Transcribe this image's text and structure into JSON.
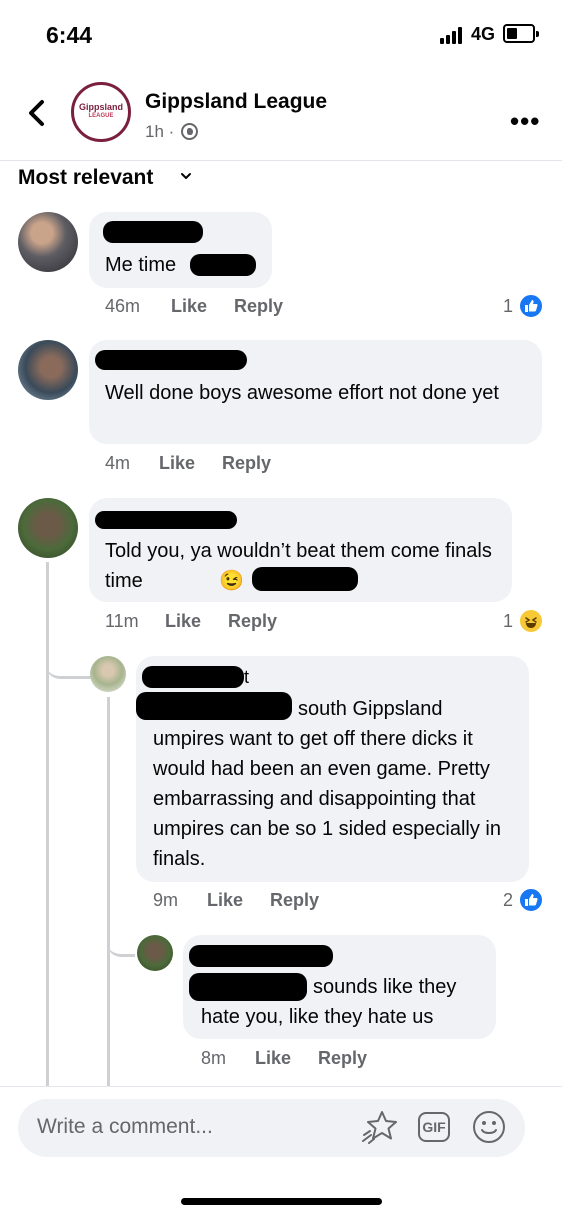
{
  "status_bar": {
    "time": "6:44",
    "network": "4G"
  },
  "header": {
    "page_name": "Gippsland League",
    "post_time": "1h ·",
    "logo_text": "Gippsland",
    "logo_sub": "LEAGUE",
    "more_label": "•••"
  },
  "sort": {
    "label": "Most relevant"
  },
  "comments": [
    {
      "text": "Me time",
      "time": "46m",
      "like_label": "Like",
      "reply_label": "Reply",
      "reaction_count": "1"
    },
    {
      "text": "Well done boys awesome effort not done yet",
      "time": "4m",
      "like_label": "Like",
      "reply_label": "Reply"
    },
    {
      "text": "Told you, ya wouldn’t beat them come finals time",
      "emoji": "😉",
      "time": "11m",
      "like_label": "Like",
      "reply_label": "Reply",
      "reaction_count": "1"
    }
  ],
  "replies": [
    {
      "name_fragment": "t",
      "text_line1": "south Gippsland",
      "text_rest": "umpires want to get off there dicks it would had been an even game. Pretty embarrassing and disappointing that umpires can be so 1 sided especially in finals.",
      "time": "9m",
      "like_label": "Like",
      "reply_label": "Reply",
      "reaction_count": "2"
    },
    {
      "text_line1": "sounds like they",
      "text_rest": "hate you, like they hate us",
      "time": "8m",
      "like_label": "Like",
      "reply_label": "Reply"
    }
  ],
  "composer": {
    "placeholder": "Write a comment...",
    "gif_label": "GIF"
  },
  "colors": {
    "accent": "#1877f2",
    "bubble": "#f0f2f5",
    "meta": "#65676b",
    "brand": "#7a1f3d"
  }
}
